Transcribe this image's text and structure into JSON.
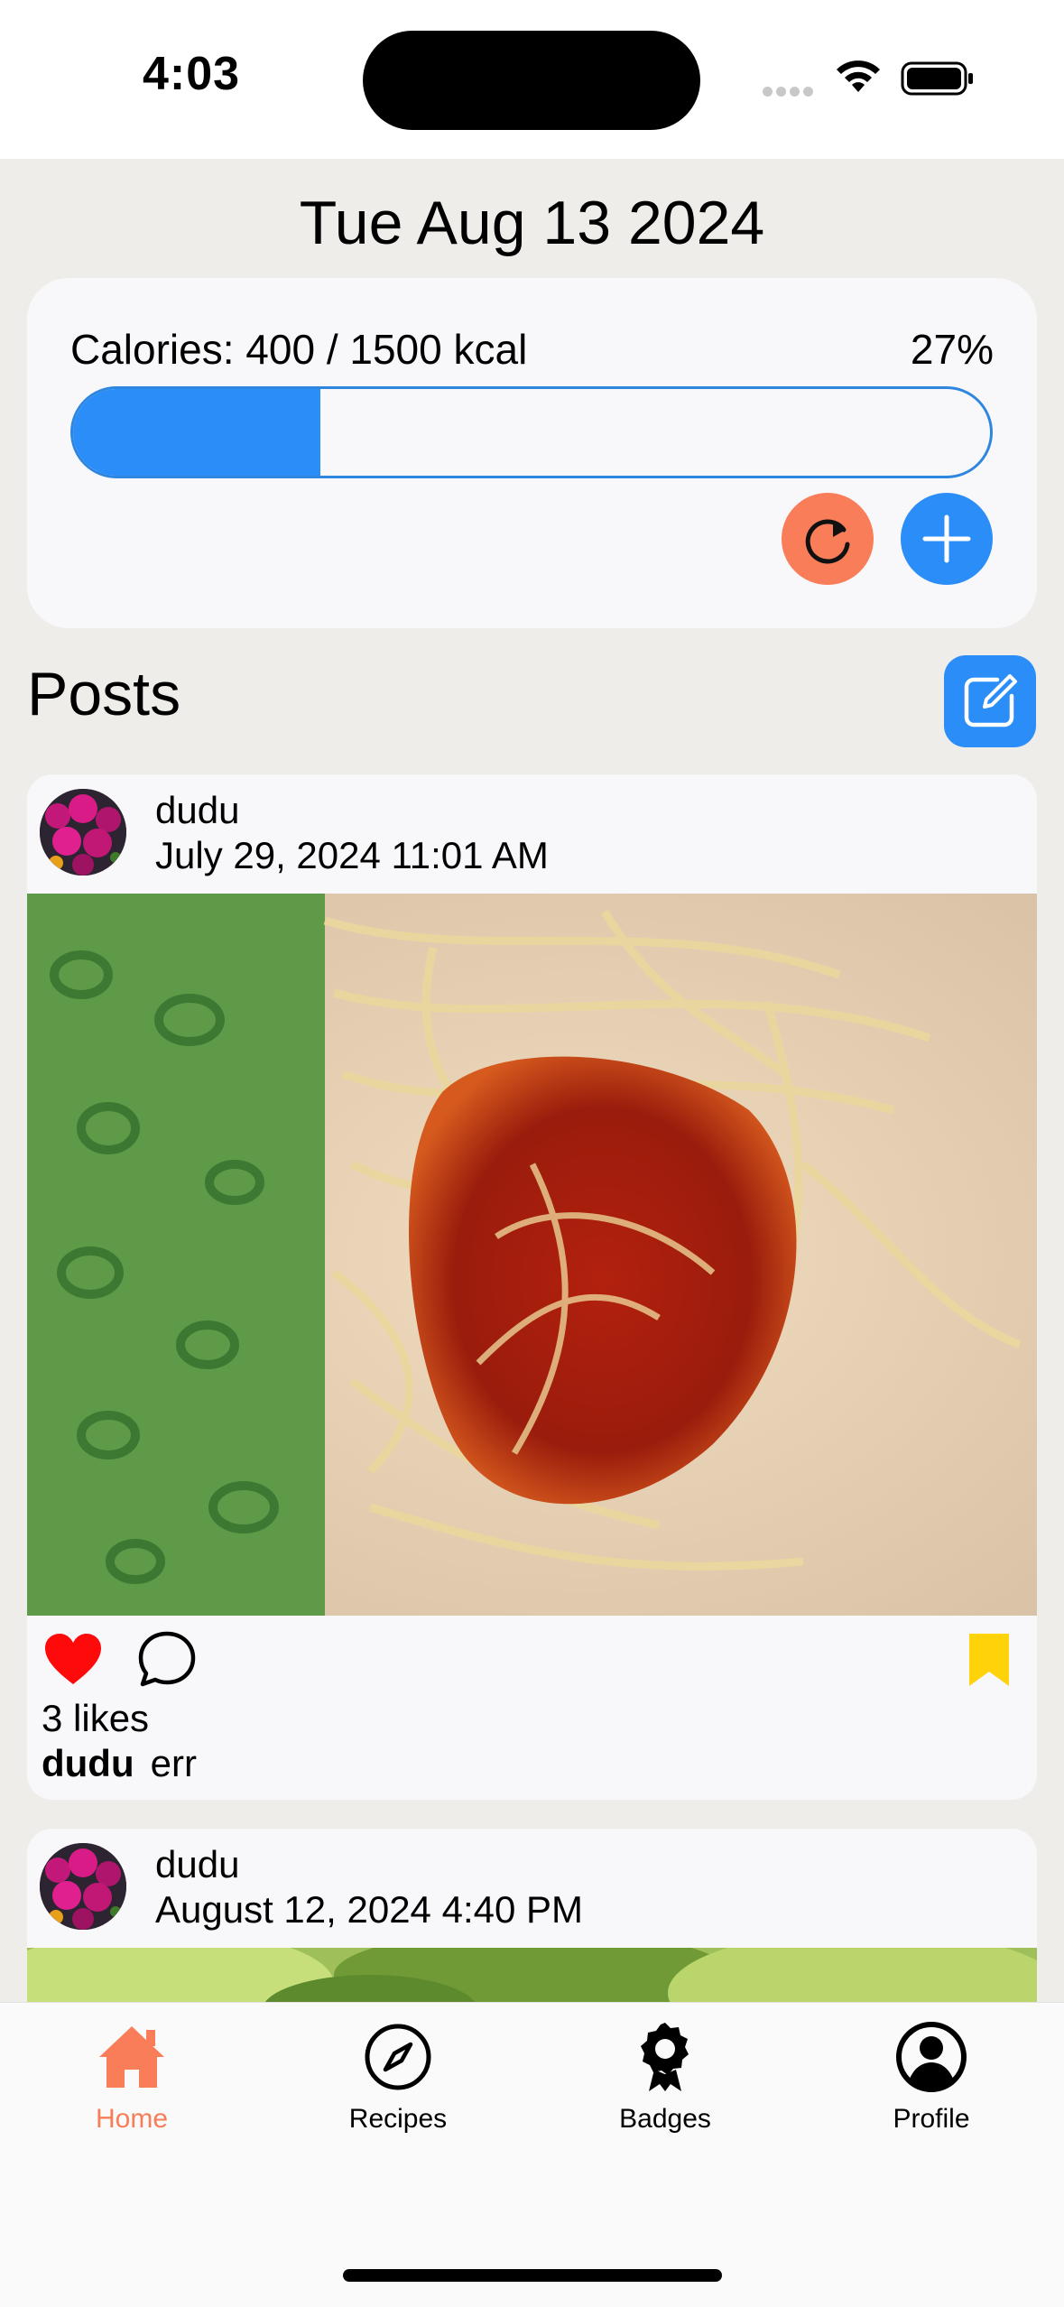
{
  "status_bar": {
    "time": "4:03"
  },
  "header": {
    "date": "Tue Aug 13 2024"
  },
  "calories": {
    "label": "Calories: 400 / 1500 kcal",
    "percent_text": "27%",
    "progress": 0.27,
    "colors": {
      "fill": "#2b8ef8",
      "refresh": "#f97d58",
      "add": "#2b8ef8"
    }
  },
  "posts_section": {
    "title": "Posts"
  },
  "posts": [
    {
      "username": "dudu",
      "date": "July 29, 2024 11:01 AM",
      "likes": "3 likes",
      "caption_user": "dudu",
      "caption_text": "err"
    },
    {
      "username": "dudu",
      "date": "August 12, 2024 4:40 PM"
    }
  ],
  "tab_bar": {
    "active": "Home",
    "accent_color": "#f97d58",
    "items": [
      {
        "label": "Home",
        "icon": "house-icon"
      },
      {
        "label": "Recipes",
        "icon": "compass-icon"
      },
      {
        "label": "Badges",
        "icon": "badge-icon"
      },
      {
        "label": "Profile",
        "icon": "person-circle-icon"
      }
    ]
  }
}
